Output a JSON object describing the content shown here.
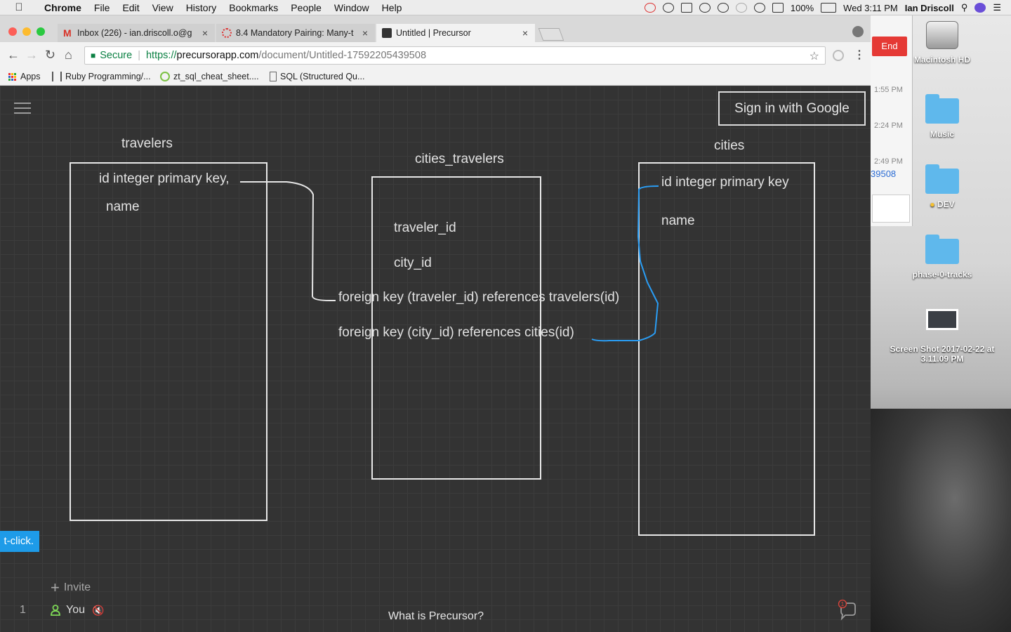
{
  "menubar": {
    "app": "Chrome",
    "items": [
      "File",
      "Edit",
      "View",
      "History",
      "Bookmarks",
      "People",
      "Window",
      "Help"
    ],
    "battery": "100%",
    "clock": "Wed 3:11 PM",
    "user": "Ian Driscoll"
  },
  "tabs": [
    {
      "title": "Inbox (226) - ian.driscoll.o@g",
      "active": false
    },
    {
      "title": "8.4 Mandatory Pairing: Many-t",
      "active": false
    },
    {
      "title": "Untitled | Precursor",
      "active": true
    }
  ],
  "address": {
    "secure_label": "Secure",
    "scheme": "https://",
    "host": "precursorapp.com",
    "path": "/document/Untitled-17592205439508"
  },
  "bookmarks": [
    "Apps",
    "Ruby Programming/...",
    "zt_sql_cheat_sheet....",
    "SQL (Structured Qu..."
  ],
  "behind_window": {
    "end_label": "End",
    "times": [
      "1:55 PM",
      "2:24 PM",
      "2:49 PM"
    ],
    "link_fragment": "39508"
  },
  "desktop": {
    "icons": [
      "Macintosh HD",
      "Music",
      "DEV",
      "phase-0-tracks",
      "Screen Shot 2017-02-22 at 3.11.09 PM"
    ]
  },
  "canvas": {
    "signin_label": "Sign in with Google",
    "tables": {
      "travelers": {
        "title": "travelers",
        "fields": [
          "id integer primary key,",
          "name"
        ]
      },
      "cities_travelers": {
        "title": "cities_travelers",
        "fields": [
          "traveler_id",
          "city_id",
          "foreign key (traveler_id) references travelers(id)",
          "foreign key (city_id) references cities(id)"
        ]
      },
      "cities": {
        "title": "cities",
        "fields": [
          "id integer primary key",
          "name"
        ]
      }
    },
    "connector_colors": {
      "white": "#e6e6e6",
      "blue": "#2a9df4"
    },
    "hint_text": "t-click.",
    "invite_label": "Invite",
    "user_count": "1",
    "user_label": "You",
    "footer_link": "What is Precursor?",
    "chat_badge": "1"
  }
}
